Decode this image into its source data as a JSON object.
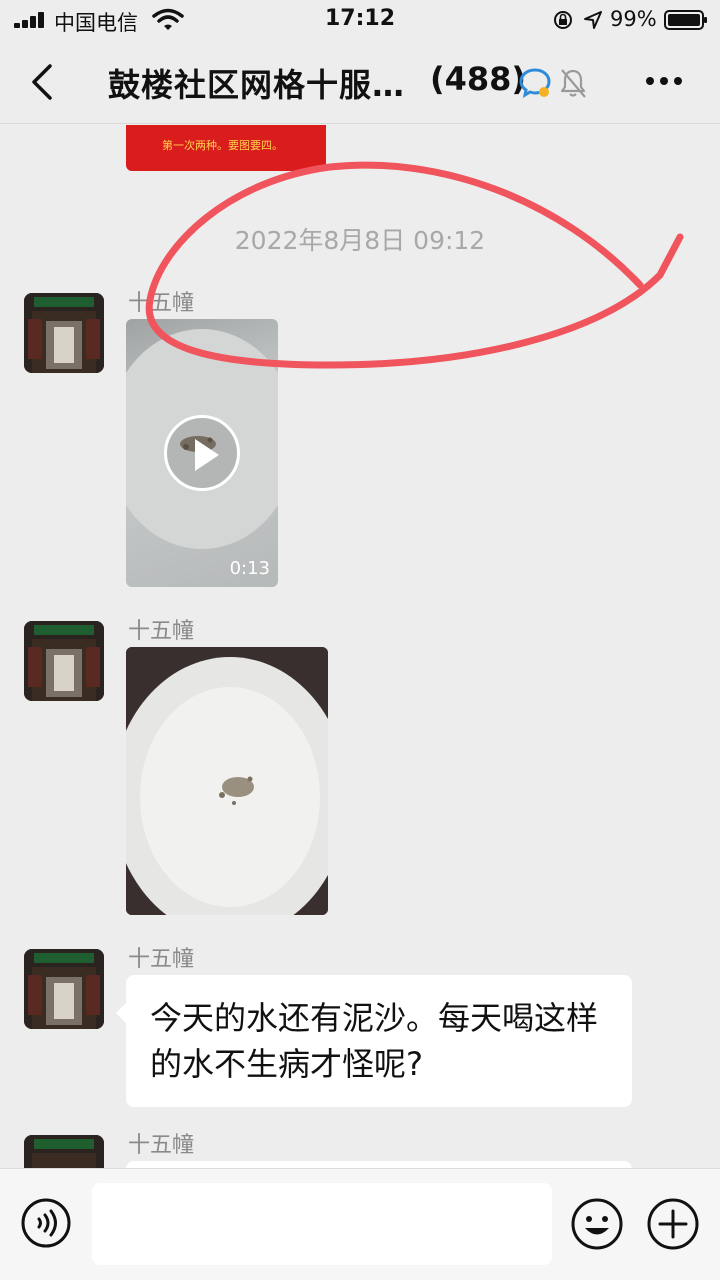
{
  "status_bar": {
    "carrier": "中国电信",
    "time": "17:12",
    "battery": "99%"
  },
  "header": {
    "title": "鼓楼社区网格十服…",
    "member_count": "(488)"
  },
  "chat": {
    "pinned_card_text": "第一次两种。要图要四。",
    "timestamp": "2022年8月8日 09:12",
    "annotation_color": "#f0545c",
    "messages": [
      {
        "sender": "十五幢",
        "type": "video",
        "duration": "0:13"
      },
      {
        "sender": "十五幢",
        "type": "image"
      },
      {
        "sender": "十五幢",
        "type": "text",
        "text": "今天的水还有泥沙。每天喝这样的水不生病才怪呢?"
      },
      {
        "sender": "十五幢",
        "type": "text",
        "text": ""
      }
    ]
  },
  "input_bar": {
    "placeholder": "",
    "icons": [
      "voice-icon",
      "emoji-icon",
      "plus-icon"
    ]
  }
}
